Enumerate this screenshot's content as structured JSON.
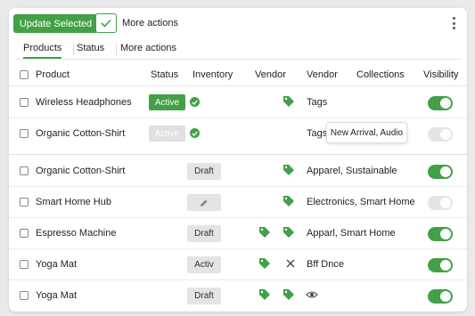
{
  "toolbar": {
    "update_label": "Update Selected",
    "more_actions_label": "More actions"
  },
  "tabs": [
    {
      "label": "Products"
    },
    {
      "label": "Status"
    },
    {
      "label": "More actions"
    }
  ],
  "columns": {
    "product": "Product",
    "status": "Status",
    "inventory": "Inventory",
    "vendor1": "Vendor",
    "vendor2": "Vendor",
    "collections": "Collections",
    "visibility": "Visibility"
  },
  "rows": [
    {
      "product": "Wireless Headphones",
      "status": "Active",
      "vendor_text": "Tags"
    },
    {
      "product": "Organic Cotton-Shirt",
      "status": "Active",
      "vendor_text": "Tags"
    },
    {
      "product": "Organic Cotton-Shirt",
      "inventory": "Draft",
      "vendor_text": "Apparel, Sustainable"
    },
    {
      "product": "Smart Home Hub",
      "vendor_text": "Electronics, Smart Home"
    },
    {
      "product": "Espresso Machine",
      "inventory": "Draft",
      "vendor_text": "Apparl, Smart Home"
    },
    {
      "product": "Yoga Mat",
      "inventory": "Activ",
      "vendor_text": "Bff Dnce"
    },
    {
      "product": "Yoga Mat",
      "inventory": "Draft"
    }
  ],
  "tooltip": "New Arrival, Audio",
  "icons": {
    "check": "check-icon",
    "kebab": "more-vertical-icon",
    "tag": "tag-icon",
    "close": "close-icon",
    "eye": "eye-icon",
    "pencil": "pencil-icon"
  },
  "colors": {
    "accent": "#43a047",
    "muted": "#e4e4e4"
  }
}
